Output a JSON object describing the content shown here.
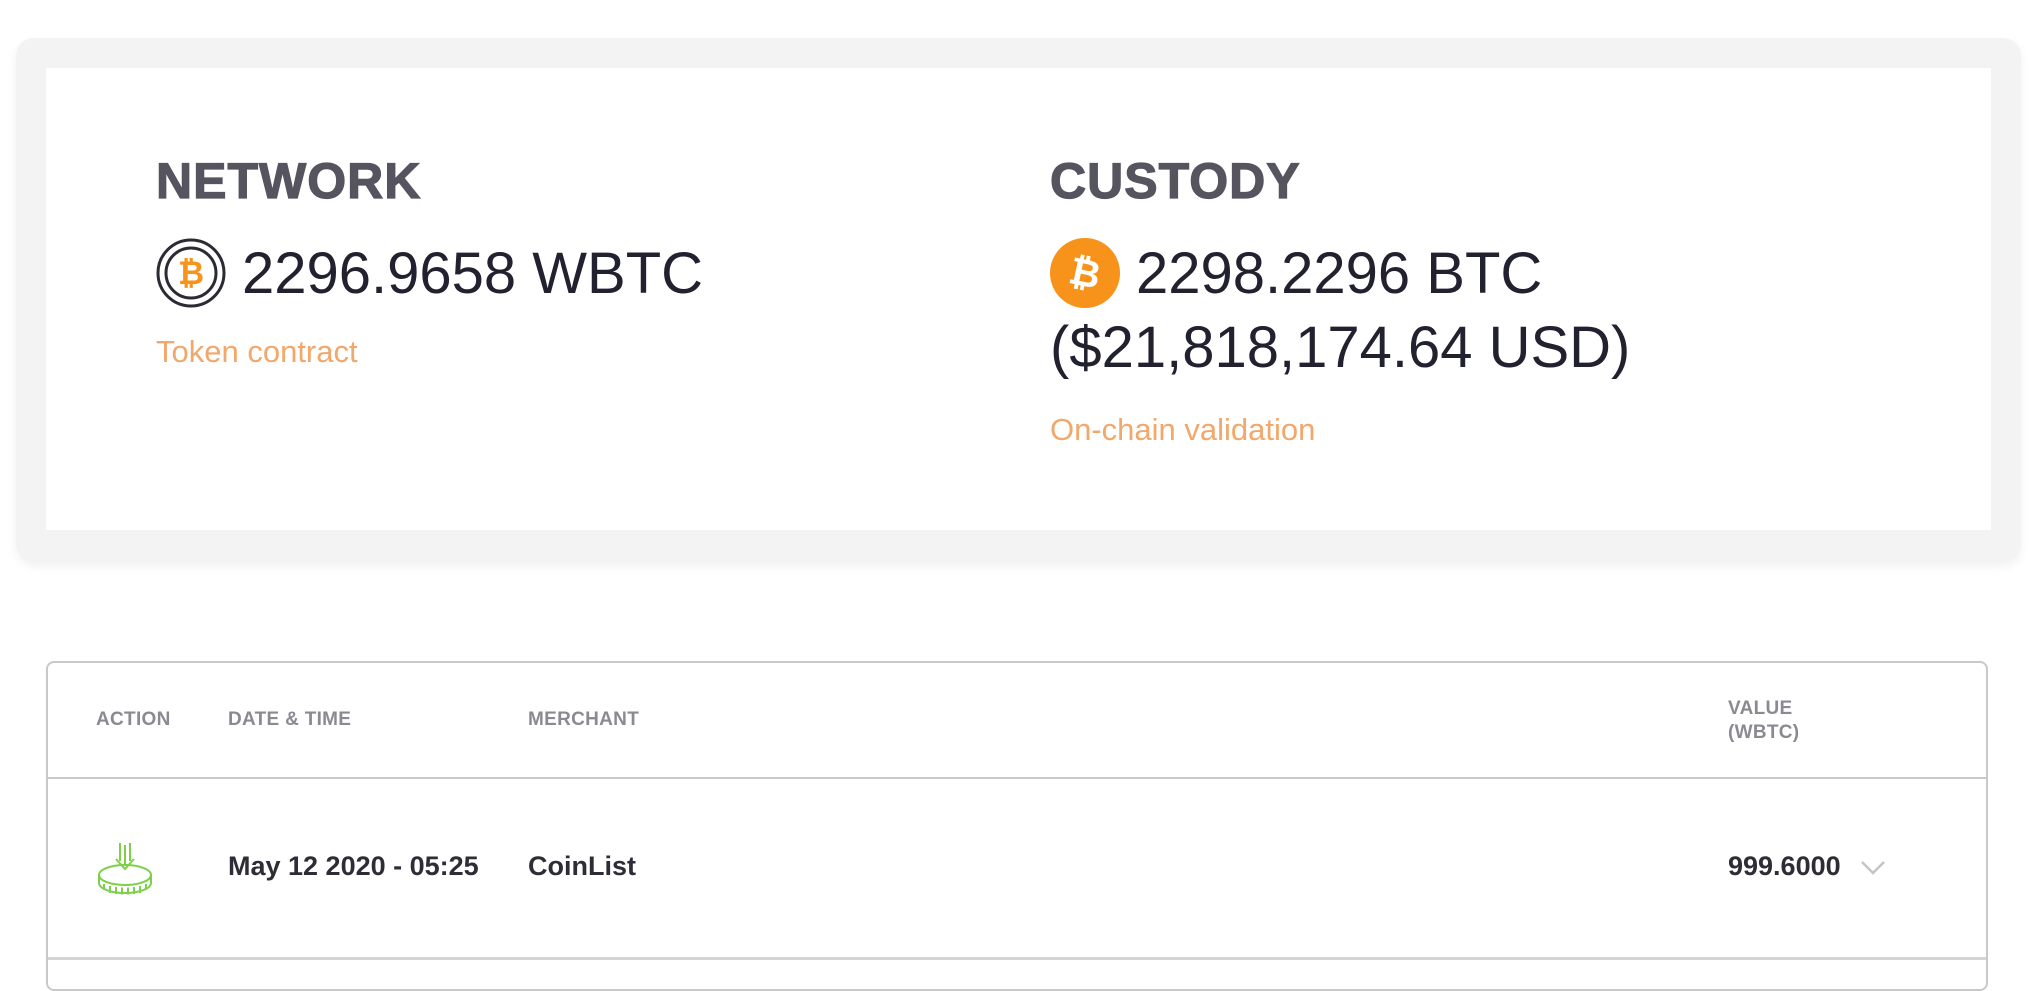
{
  "summary": {
    "network": {
      "heading": "NETWORK",
      "amount": "2296.9658 WBTC",
      "icon": "wbtc-coin-icon",
      "link_label": "Token contract"
    },
    "custody": {
      "heading": "CUSTODY",
      "amount": "2298.2296 BTC",
      "usd_value": "($21,818,174.64 USD)",
      "icon": "btc-coin-icon",
      "link_label": "On-chain validation"
    }
  },
  "transactions": {
    "columns": {
      "action": "ACTION",
      "date_time": "DATE & TIME",
      "merchant": "MERCHANT",
      "value_line1": "VALUE",
      "value_line2": "(WBTC)"
    },
    "rows": [
      {
        "action_icon": "mint-coin-icon",
        "date_time": "May 12 2020 - 05:25",
        "merchant": "CoinList",
        "value": "999.6000"
      }
    ]
  },
  "colors": {
    "accent_orange": "#f7931a",
    "link_orange": "#f2a76b",
    "mint_green": "#7ed04b",
    "heading_gray": "#55545f",
    "text_dark": "#22212f"
  }
}
